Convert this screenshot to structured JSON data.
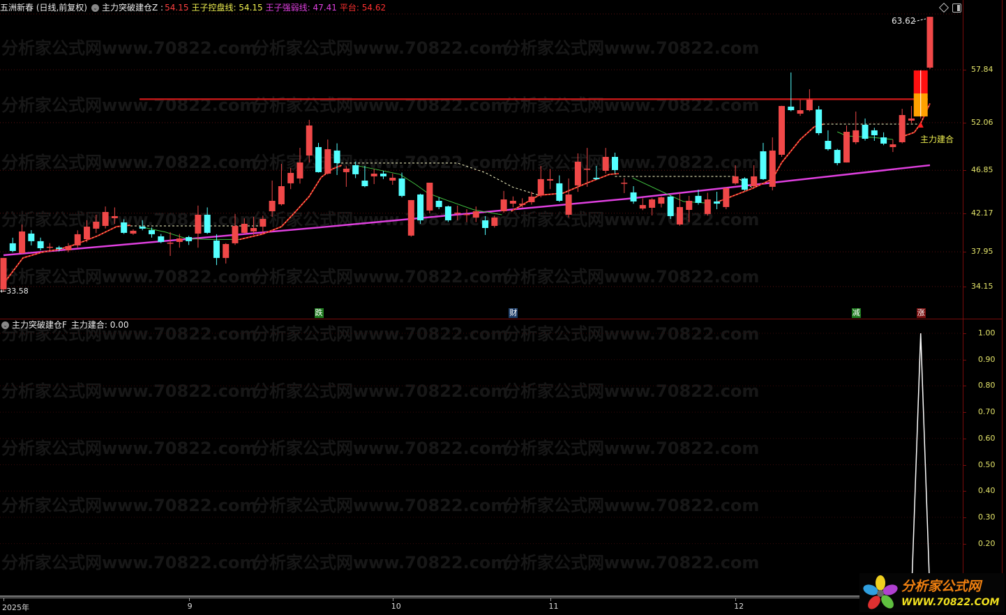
{
  "header": {
    "stock": "五洲新春 (日线,前复权)",
    "indicator": "主力突破建仓Z :",
    "indicator_value": "54.15",
    "line1_label": "王子控盘线: 54.15",
    "line2_label": "王子强弱线: 47.41",
    "line3_label": "平台: 54.62"
  },
  "indicator_panel": {
    "title": "主力突破建仓F",
    "value_label": "主力建合: 0.00"
  },
  "annotations": {
    "high_label": "63.62",
    "low_label": "←33.58",
    "signal_label": "主力建合"
  },
  "watermark": "分析家公式网www.70822.com",
  "logo": {
    "title": "分析家公式网",
    "url": "WWW.70822.COM"
  },
  "colors": {
    "up": "#f04848",
    "down": "#54ffff",
    "highlight_low": "#ffa000",
    "highlight_high": "#ff1010",
    "control_rise": "#e02020",
    "control_fall": "#40c040",
    "strength": "#e040e0",
    "platform": "#c01818",
    "axis": "#e4e46a",
    "border": "#7a0c0c"
  },
  "chart_data": [
    {
      "type": "candlestick",
      "title": "五洲新春 (日线,前复权)",
      "y_ticks": [
        "57.84",
        "52.06",
        "46.85",
        "42.17",
        "37.95",
        "34.15"
      ],
      "ylim": [
        33.0,
        64.5
      ],
      "x_ticks": [
        {
          "label": "2025年",
          "index": 0
        },
        {
          "label": "9",
          "index": 20
        },
        {
          "label": "10",
          "index": 42
        },
        {
          "label": "11",
          "index": 59
        },
        {
          "label": "12",
          "index": 79
        }
      ],
      "candles_ohlc": [
        [
          33.85,
          37.28,
          37.28,
          33.58
        ],
        [
          38.88,
          38.04,
          39.49,
          37.89
        ],
        [
          37.81,
          40.17,
          40.93,
          37.7
        ],
        [
          39.94,
          39.11,
          40.32,
          38.65
        ],
        [
          39.11,
          38.34,
          39.5,
          38.1
        ],
        [
          38.5,
          38.5,
          38.9,
          38.1
        ],
        [
          38.42,
          38.27,
          38.6,
          38.0
        ],
        [
          38.12,
          38.57,
          38.9,
          37.9
        ],
        [
          38.65,
          39.87,
          40.3,
          38.4
        ],
        [
          39.33,
          40.7,
          41.4,
          39.0
        ],
        [
          40.48,
          41.24,
          42.0,
          40.0
        ],
        [
          40.78,
          42.3,
          42.9,
          40.5
        ],
        [
          41.62,
          41.85,
          42.8,
          41.0
        ],
        [
          41.16,
          40.02,
          41.5,
          39.9
        ],
        [
          39.94,
          40.25,
          40.4,
          39.8
        ],
        [
          40.7,
          40.48,
          41.4,
          40.3
        ],
        [
          40.32,
          39.87,
          40.6,
          39.5
        ],
        [
          39.64,
          39.03,
          39.9,
          38.9
        ],
        [
          38.95,
          38.95,
          40.1,
          37.5
        ],
        [
          39.03,
          39.41,
          39.9,
          38.4
        ],
        [
          39.56,
          39.11,
          39.7,
          38.7
        ],
        [
          39.94,
          42.0,
          43.0,
          38.4
        ],
        [
          42.0,
          40.02,
          42.8,
          39.9
        ],
        [
          39.18,
          37.28,
          39.87,
          36.5
        ],
        [
          37.28,
          38.8,
          38.9,
          36.67
        ],
        [
          38.88,
          40.78,
          42.08,
          38.7
        ],
        [
          40.02,
          41.01,
          41.6,
          39.9
        ],
        [
          40.17,
          40.55,
          41.77,
          39.8
        ],
        [
          40.7,
          41.54,
          41.9,
          40.0
        ],
        [
          42.38,
          43.52,
          45.73,
          41.77
        ],
        [
          43.14,
          45.12,
          47.56,
          43.0
        ],
        [
          45.43,
          46.57,
          47.1,
          44.8
        ],
        [
          45.96,
          47.71,
          49.31,
          45.4
        ],
        [
          48.47,
          51.75,
          52.36,
          47.71
        ],
        [
          49.39,
          46.65,
          49.85,
          46.6
        ],
        [
          46.49,
          49.16,
          50.22,
          46.4
        ],
        [
          49.01,
          47.64,
          49.8,
          46.34
        ],
        [
          46.65,
          47.03,
          47.3,
          45.05
        ],
        [
          47.41,
          46.42,
          47.8,
          46.0
        ],
        [
          45.73,
          45.12,
          47.33,
          45.0
        ],
        [
          46.19,
          46.49,
          47.0,
          45.35
        ],
        [
          46.49,
          46.19,
          46.8,
          45.9
        ],
        [
          45.73,
          46.04,
          46.5,
          45.27
        ],
        [
          45.96,
          44.06,
          46.6,
          43.9
        ],
        [
          39.72,
          43.6,
          43.6,
          39.6
        ],
        [
          44.21,
          41.39,
          44.3,
          41.0
        ],
        [
          42.46,
          45.5,
          45.5,
          42.15
        ],
        [
          43.52,
          42.84,
          43.9,
          42.6
        ],
        [
          42.91,
          41.39,
          43.0,
          41.2
        ],
        [
          42.23,
          42.23,
          43.0,
          41.4
        ],
        [
          42.07,
          42.07,
          42.6,
          41.2
        ],
        [
          41.69,
          42.38,
          42.9,
          41.2
        ],
        [
          41.39,
          40.55,
          41.85,
          39.79
        ],
        [
          40.78,
          41.69,
          41.9,
          40.6
        ],
        [
          42.38,
          43.67,
          44.6,
          42.2
        ],
        [
          43.21,
          43.52,
          44.0,
          42.8
        ],
        [
          43.06,
          43.21,
          43.8,
          42.8
        ],
        [
          43.37,
          43.98,
          44.5,
          43.1
        ],
        [
          44.13,
          45.89,
          47.33,
          43.9
        ],
        [
          45.73,
          45.89,
          47.0,
          44.8
        ],
        [
          45.43,
          43.52,
          46.3,
          43.4
        ],
        [
          42.0,
          44.21,
          45.96,
          41.7
        ],
        [
          45.2,
          47.79,
          48.7,
          44.5
        ],
        [
          47.03,
          47.03,
          49.3,
          45.05
        ],
        [
          46.04,
          45.89,
          47.33,
          45.8
        ],
        [
          46.8,
          48.32,
          49.3,
          46.5
        ],
        [
          48.32,
          46.88,
          48.78,
          46.5
        ],
        [
          45.5,
          45.5,
          46.0,
          44.36
        ],
        [
          44.44,
          43.45,
          45.12,
          43.2
        ],
        [
          42.68,
          43.06,
          43.8,
          42.5
        ],
        [
          42.76,
          43.67,
          43.8,
          41.92
        ],
        [
          43.21,
          43.9,
          44.0,
          42.8
        ],
        [
          43.98,
          41.85,
          44.1,
          41.54
        ],
        [
          40.93,
          42.84,
          44.36,
          40.8
        ],
        [
          42.53,
          43.52,
          44.06,
          41.2
        ],
        [
          44.06,
          43.29,
          44.74,
          43.1
        ],
        [
          42.08,
          43.67,
          44.4,
          41.9
        ],
        [
          43.45,
          43.21,
          44.51,
          42.6
        ],
        [
          42.84,
          44.9,
          45.0,
          42.6
        ],
        [
          45.43,
          46.19,
          47.41,
          45.3
        ],
        [
          45.96,
          44.74,
          46.1,
          44.6
        ],
        [
          45.12,
          46.19,
          47.41,
          45.0
        ],
        [
          48.93,
          45.89,
          49.85,
          45.8
        ],
        [
          45.05,
          49.01,
          50.45,
          44.66
        ],
        [
          48.55,
          53.88,
          53.9,
          48.32
        ],
        [
          53.81,
          53.42,
          57.54,
          53.3
        ],
        [
          53.04,
          53.42,
          54.57,
          52.8
        ],
        [
          53.42,
          54.57,
          55.71,
          53.3
        ],
        [
          53.5,
          50.91,
          53.88,
          50.7
        ],
        [
          50.07,
          49.16,
          51.22,
          49.0
        ],
        [
          49.08,
          47.64,
          49.2,
          47.4
        ],
        [
          47.71,
          51.06,
          51.75,
          47.7
        ],
        [
          49.92,
          51.22,
          53.27,
          49.7
        ],
        [
          51.83,
          50.3,
          52.51,
          50.1
        ],
        [
          51.22,
          50.68,
          51.5,
          50.07
        ],
        [
          50.45,
          49.77,
          51.0,
          49.6
        ],
        [
          49.39,
          49.69,
          50.2,
          48.85
        ],
        [
          49.92,
          52.89,
          53.57,
          49.8
        ],
        [
          52.28,
          52.51,
          53.88,
          52.0
        ],
        [
          52.74,
          57.76,
          57.8,
          52.51
        ],
        [
          58.07,
          63.62,
          63.62,
          57.92
        ]
      ],
      "highlight": {
        "index": 99,
        "split_price": 55.25
      },
      "platform_price": 54.62,
      "strength_line": [
        [
          0,
          37.58
        ],
        [
          34.3,
          40.63
        ],
        [
          67.4,
          43.75
        ],
        [
          100,
          47.41
        ]
      ],
      "control_line_segments": [
        {
          "trend": "rise",
          "points": [
            [
              0,
              34.46
            ],
            [
              2.1,
              37.28
            ],
            [
              4.1,
              37.89
            ],
            [
              6.2,
              38.27
            ],
            [
              7.9,
              38.8
            ],
            [
              10.2,
              39.71
            ],
            [
              12.2,
              40.7
            ],
            [
              13.7,
              40.85
            ]
          ]
        },
        {
          "trend": "fall",
          "points": [
            [
              14.7,
              40.7
            ],
            [
              17.5,
              40.1
            ],
            [
              19.7,
              39.41
            ],
            [
              22,
              39.3
            ],
            [
              25.5,
              39.3
            ]
          ]
        },
        {
          "trend": "rise",
          "points": [
            [
              25.5,
              39.3
            ],
            [
              28,
              39.9
            ],
            [
              30,
              40.7
            ],
            [
              31.4,
              42.2
            ],
            [
              33,
              44.0
            ],
            [
              34.3,
              46.1
            ],
            [
              35.5,
              47.0
            ],
            [
              36.5,
              47.4
            ]
          ]
        },
        {
          "trend": "fall",
          "points": [
            [
              37.9,
              47.41
            ],
            [
              40,
              47.0
            ],
            [
              42.8,
              46.41
            ],
            [
              44.5,
              45.3
            ],
            [
              45.8,
              44.36
            ],
            [
              47.8,
              43.6
            ],
            [
              50.8,
              42.53
            ],
            [
              53.8,
              42.0
            ]
          ]
        },
        {
          "trend": "rise",
          "points": [
            [
              54.8,
              42.38
            ],
            [
              57.8,
              44.13
            ],
            [
              60.4,
              44.36
            ],
            [
              62.9,
              45.43
            ],
            [
              65.4,
              46.41
            ],
            [
              66.4,
              46.49
            ]
          ]
        },
        {
          "trend": "fall",
          "points": [
            [
              67.9,
              46.03
            ],
            [
              71.9,
              44.13
            ],
            [
              73.4,
              43.44
            ],
            [
              75.7,
              43.29
            ]
          ]
        },
        {
          "trend": "rise",
          "points": [
            [
              77,
              43.37
            ],
            [
              80.9,
              44.9
            ],
            [
              83,
              45.9
            ],
            [
              84,
              47.7
            ],
            [
              86,
              50.22
            ],
            [
              87.5,
              51.6
            ],
            [
              88.5,
              51.9
            ]
          ]
        },
        {
          "trend": "fall",
          "points": [
            [
              90,
              51.06
            ],
            [
              91,
              50.6
            ],
            [
              93.8,
              50.45
            ],
            [
              96,
              50.22
            ]
          ]
        },
        {
          "trend": "rise",
          "points": [
            [
              97,
              50.53
            ],
            [
              98.3,
              50.99
            ],
            [
              99,
              51.97
            ],
            [
              100,
              54.15
            ]
          ]
        }
      ],
      "platform_dashes": [
        {
          "points": [
            [
              13.7,
              40.78
            ],
            [
              28,
              40.78
            ]
          ]
        },
        {
          "points": [
            [
              36,
              47.64
            ],
            [
              49,
              47.64
            ],
            [
              52,
              46.6
            ],
            [
              55,
              45.0
            ],
            [
              57.8,
              44.13
            ]
          ]
        },
        {
          "points": [
            [
              66,
              46.19
            ],
            [
              79,
              46.19
            ],
            [
              80.9,
              44.9
            ]
          ]
        },
        {
          "points": [
            [
              88,
              51.9
            ],
            [
              99,
              51.9
            ]
          ]
        }
      ],
      "event_markers": [
        {
          "label": "跌",
          "index": 34,
          "color": "#1f7a1f"
        },
        {
          "label": "财",
          "index": 55,
          "color": "#1f3f6a"
        },
        {
          "label": "减",
          "index": 92,
          "color": "#1f7a1f"
        },
        {
          "label": "涨",
          "index": 99,
          "color": "#7a1010"
        }
      ]
    },
    {
      "type": "line",
      "title": "主力突破建仓F",
      "series_name": "主力建合",
      "y_ticks": [
        "1.00",
        "0.90",
        "0.80",
        "0.70",
        "0.60",
        "0.50",
        "0.40",
        "0.30",
        "0.20"
      ],
      "ylim": [
        0,
        1.0
      ],
      "signal": [
        [
          98,
          0
        ],
        [
          99,
          1.0
        ],
        [
          100,
          0
        ]
      ]
    }
  ]
}
